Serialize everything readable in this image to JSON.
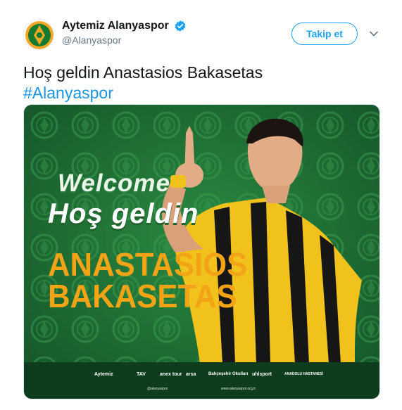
{
  "tweet": {
    "display_name": "Aytemiz Alanyaspor",
    "handle": "@Alanyaspor",
    "follow_label": "Takip et",
    "text": "Hoş geldin Anastasios Bakasetas",
    "hashtag": "#Alanyaspor"
  },
  "media": {
    "welcome": "Welcome",
    "hos_geldin": "Hoş geldin",
    "first_name": "ANASTASIOS",
    "last_name": "BAKASETAS",
    "sponsors": [
      "Aytemiz",
      "TAV",
      "anex tour",
      "arsa",
      "Bahçeşehir Okulları",
      "uhlsport",
      "ANADOLU HASTANESİ"
    ],
    "footer_left": "@alanyaspor",
    "footer_right": "www.alanyaspor.org.tr"
  },
  "colors": {
    "accent": "#1da1f2",
    "hashtag": "#1b95e0",
    "name_orange": "#f3a416",
    "bg_green": "#1e6b32"
  },
  "icons": {
    "verified": "verified-badge-icon",
    "more": "chevron-down-icon",
    "avatar": "alanyaspor-crest"
  }
}
